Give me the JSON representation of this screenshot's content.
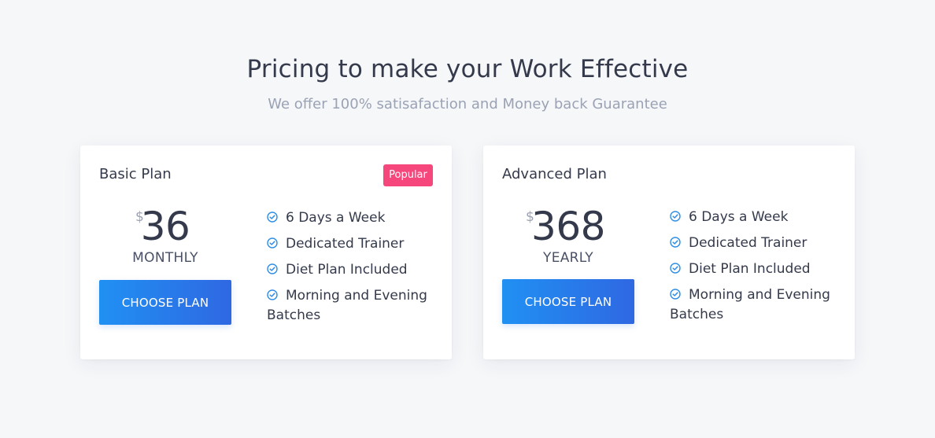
{
  "header": {
    "title": "Pricing to make your Work Effective",
    "subtitle": "We offer 100% satisafaction and Money back Guarantee"
  },
  "plans": [
    {
      "name": "Basic Plan",
      "badge": "Popular",
      "currency": "$",
      "price": "36",
      "period": "MONTHLY",
      "cta": "CHOOSE PLAN",
      "features": [
        "6 Days a Week",
        "Dedicated Trainer",
        "Diet Plan Included",
        "Morning and Evening Batches"
      ]
    },
    {
      "name": "Advanced Plan",
      "currency": "$",
      "price": "368",
      "period": "YEARLY",
      "cta": "CHOOSE PLAN",
      "features": [
        "6 Days a Week",
        "Dedicated Trainer",
        "Diet Plan Included",
        "Morning and Evening Batches"
      ]
    }
  ],
  "colors": {
    "background": "#f6f7f9",
    "text": "#343a4b",
    "muted": "#9aa2b4",
    "badge": "#f5477c",
    "button_start": "#2090f3",
    "button_end": "#2f68e2",
    "check": "#2f8de4"
  },
  "icons": {
    "feature": "check-circle-icon"
  }
}
